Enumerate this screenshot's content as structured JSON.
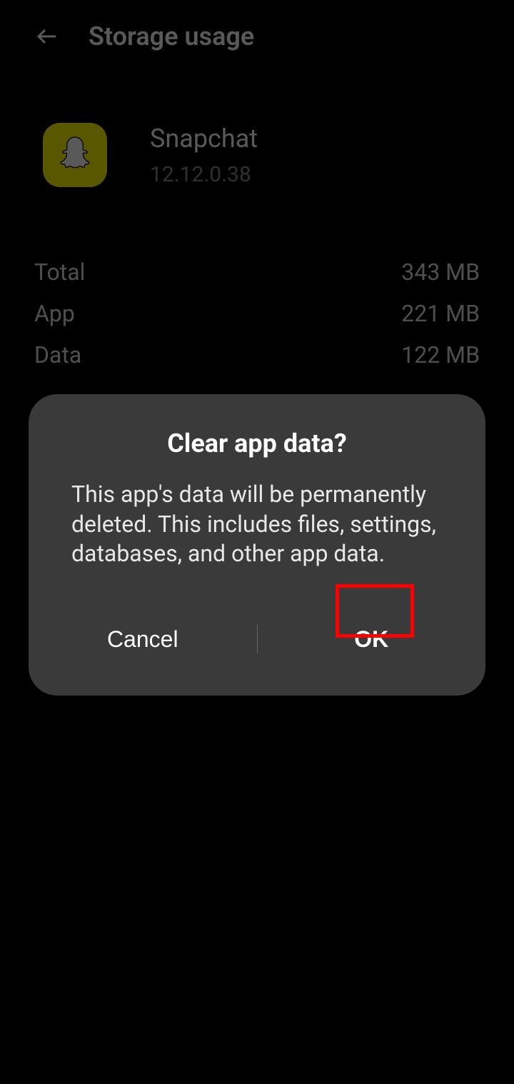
{
  "header": {
    "title": "Storage usage"
  },
  "app": {
    "name": "Snapchat",
    "version": "12.12.0.38"
  },
  "storage": {
    "rows": [
      {
        "label": "Total",
        "value": "343 MB"
      },
      {
        "label": "App",
        "value": "221 MB"
      },
      {
        "label": "Data",
        "value": "122 MB"
      }
    ]
  },
  "dialog": {
    "title": "Clear app data?",
    "message": "This app's data will be permanently deleted. This includes files, settings, databases, and other app data.",
    "cancel": "Cancel",
    "ok": "OK"
  }
}
